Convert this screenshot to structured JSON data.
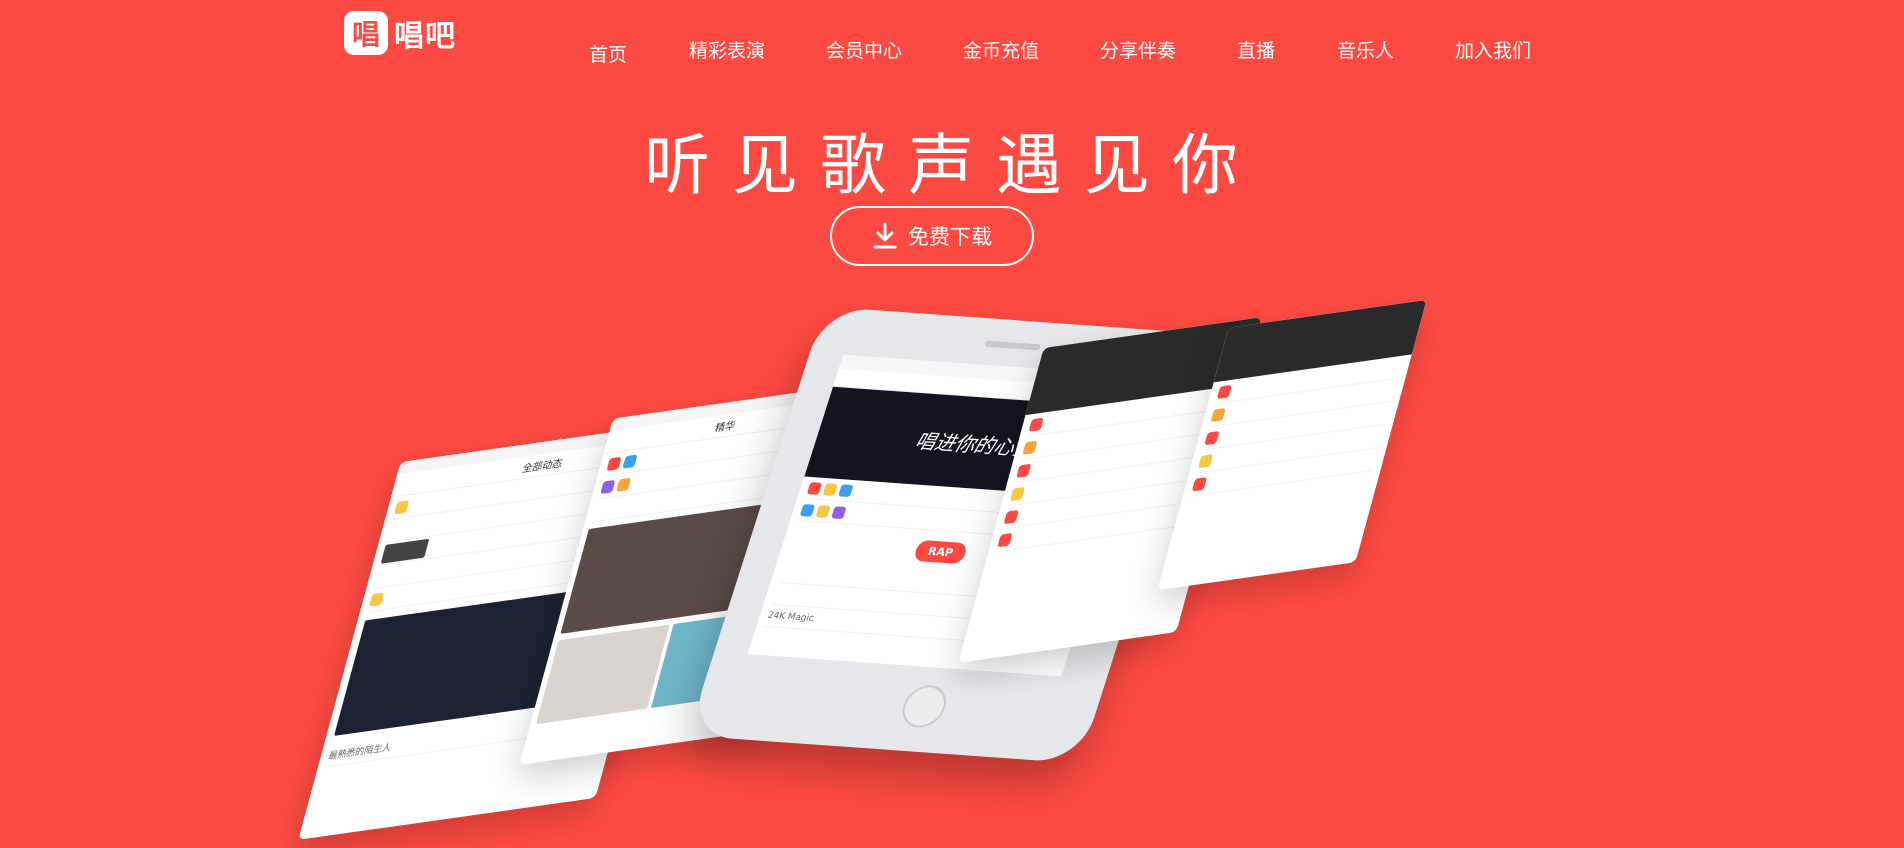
{
  "brand": {
    "logo_glyph": "唱",
    "name": "唱吧"
  },
  "nav": {
    "items": [
      "首页",
      "精彩表演",
      "会员中心",
      "金币充值",
      "分享伴奏",
      "直播",
      "音乐人",
      "加入我们"
    ]
  },
  "hero": {
    "title": "听见歌声遇见你",
    "download_label": "免费下载"
  },
  "colors": {
    "background": "#fc4a42",
    "text": "#ffffff"
  },
  "phones": {
    "feed_header": "全部动态",
    "mid_header": "精华",
    "center_banner": "唱进你的心里",
    "center_badge": "RAP",
    "center_song": "24K Magic",
    "song_caption": "最熟悉的陌生人"
  }
}
